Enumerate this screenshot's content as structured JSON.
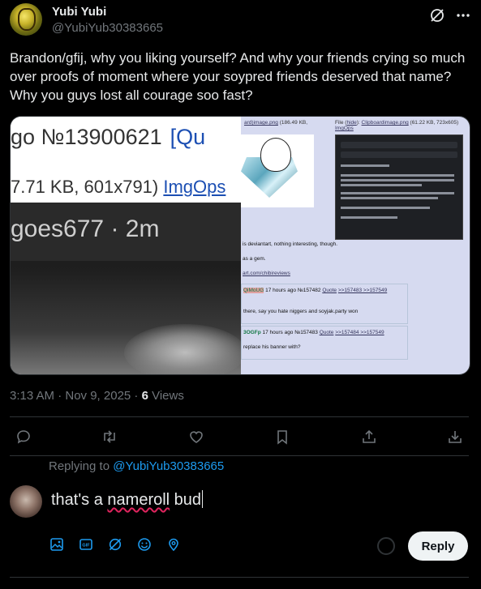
{
  "tweet": {
    "author_name": "Yubi Yubi",
    "author_handle": "@YubiYub30383665",
    "text": "Brandon/gfij, why you liking yourself? And why your friends crying so much over proofs of moment where your soypred friends deserved that name? Why you guys lost all courage soo fast?",
    "time": "3:13 AM · Nov 9, 2025 · ",
    "views_count": "6",
    "views_label": " Views"
  },
  "media": {
    "left": {
      "post_number": "go №13900621",
      "quote_link": "[Qu",
      "file_info": "7.71 KB, 601x791) ",
      "imgops": "ImgOps",
      "username_time": "goes677 · 2m"
    },
    "right": {
      "file_a": "ard)image.png",
      "file_a_info": "(186.49 KB,",
      "file_b_label": "File (",
      "file_b_hide": "hide",
      "file_b_sep": "): ",
      "file_b_link": "Clipboardimage.png",
      "file_b_info": "(61.22 KB, 723x605)",
      "file_b_imgops": "ImgOps",
      "line1": "is deviantart, nothing interesting, though.",
      "line2": "as a gem.",
      "line3": "art.com/chibireviews",
      "reply1_id": "QiMoUG",
      "reply1_meta": " 17 hours ago №157482 ",
      "reply1_quote": "Quote",
      "reply1_refs": ">>157483 >>157549",
      "reply1_text": "there, say you hate niggers and soyjak.party won",
      "reply2_id": "3OGFp",
      "reply2_meta": " 17 hours ago №157483 ",
      "reply2_quote": "Quote",
      "reply2_refs": ">>157484 >>157549",
      "reply2_text": "replace his banner with?"
    }
  },
  "reply": {
    "replying_label": "Replying to ",
    "replying_handle": "@YubiYub30383665",
    "draft_prefix": "that's a ",
    "draft_misspelled": "nameroll",
    "draft_suffix": " bud",
    "button_label": "Reply"
  },
  "icons": {
    "header": [
      "grok-icon",
      "more-icon"
    ],
    "actions": [
      "reply-icon",
      "retweet-icon",
      "like-icon",
      "bookmark-icon",
      "share-icon",
      "download-icon"
    ],
    "toolbar": [
      "image-icon",
      "gif-icon",
      "grok-icon",
      "emoji-icon",
      "location-icon"
    ]
  },
  "colors": {
    "background": "#000000",
    "text_primary": "#e7e9ea",
    "text_secondary": "#71767b",
    "accent": "#1d9bf0",
    "divider": "#2f3336",
    "reply_button_bg": "#eff3f4"
  }
}
